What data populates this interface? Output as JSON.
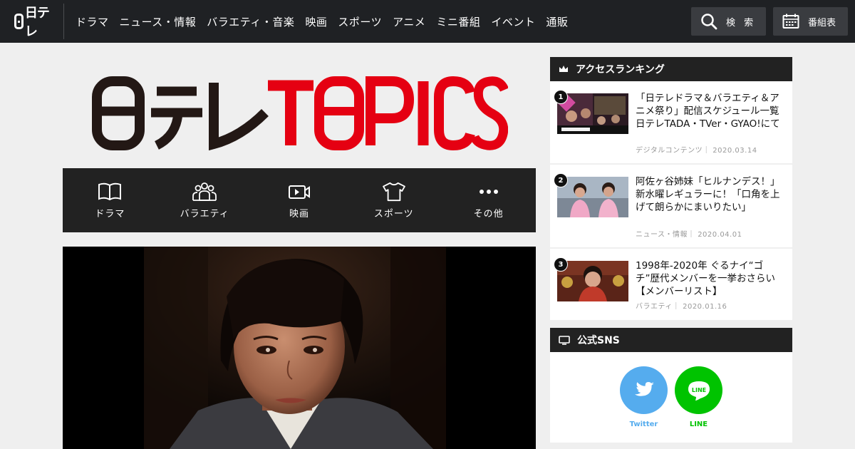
{
  "header": {
    "brand": "日テレ",
    "nav": [
      "ドラマ",
      "ニュース・情報",
      "バラエティ・音楽",
      "映画",
      "スポーツ",
      "アニメ",
      "ミニ番組",
      "イベント",
      "通販"
    ],
    "search_label": "検 索",
    "program_label": "番組表"
  },
  "logo": {
    "text_dark": "日テレ",
    "text_red": "T0PICS"
  },
  "categories": [
    {
      "label": "ドラマ",
      "icon": "book-icon"
    },
    {
      "label": "バラエティ",
      "icon": "group-icon"
    },
    {
      "label": "映画",
      "icon": "video-icon"
    },
    {
      "label": "スポーツ",
      "icon": "shirt-icon"
    },
    {
      "label": "その他",
      "icon": "more-icon"
    }
  ],
  "ranking": {
    "heading": "アクセスランキング",
    "items": [
      {
        "rank": "1",
        "title": "「日テレドラマ＆バラエティ＆アニメ祭り」配信スケジュール一覧 日テレTADA・TVer・GYAO!にて",
        "category": "デジタルコンテンツ",
        "date": "2020.03.14"
      },
      {
        "rank": "2",
        "title": "阿佐ヶ谷姉妹「ヒルナンデス！」新水曜レギュラーに！「口角を上げて朗らかにまいりたい」",
        "category": "ニュース・情報",
        "date": "2020.04.01"
      },
      {
        "rank": "3",
        "title": "1998年-2020年 ぐるナイ“ゴチ”歴代メンバーを一挙おさらい【メンバーリスト】",
        "category": "バラエティ",
        "date": "2020.01.16"
      }
    ]
  },
  "sns": {
    "heading": "公式SNS",
    "twitter_label": "Twitter",
    "line_label": "LINE",
    "line_icon_text": "LINE"
  },
  "colors": {
    "accent_red": "#e50012",
    "twitter": "#55acee",
    "line": "#00c300",
    "header_bg": "#1f2124"
  }
}
